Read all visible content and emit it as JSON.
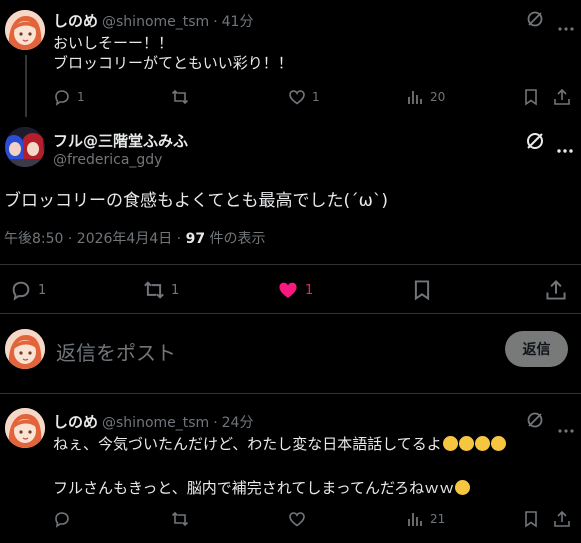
{
  "reply1": {
    "name": "しのめ",
    "handle": "@shinome_tsm",
    "time": "41分",
    "text": "おいしそーー！！\nブロッコリーがてともいい彩り！！",
    "replies": "1",
    "retweets": "",
    "likes": "1",
    "views": "20"
  },
  "main_post": {
    "name": "フル@三階堂ふみふ",
    "handle": "@frederica_gdy",
    "text": "ブロッコリーの食感もよくてとも最高でした(´ω`)",
    "timestamp": "午後8:50 · 2026年4月4日 · ",
    "view_count": "97",
    "view_suffix": " 件の表示",
    "replies": "1",
    "retweets": "1",
    "likes": "1",
    "like_color": "#f91880"
  },
  "composer": {
    "placeholder": "返信をポスト",
    "button_label": "返信"
  },
  "reply2": {
    "name": "しのめ",
    "handle": "@shinome_tsm",
    "time": "24分",
    "line1": "ねぇ、今気づいたんだけど、わたし変な日本語話してるよ",
    "line2": "フルさんもきっと、脳内で補完されてしまってんだろねｗｗ",
    "replies": "",
    "retweets": "",
    "likes": "",
    "views": "21"
  },
  "icons": [
    "grok-icon",
    "more-icon",
    "reply-icon",
    "retweet-icon",
    "like-icon",
    "views-icon",
    "bookmark-icon",
    "share-icon"
  ]
}
